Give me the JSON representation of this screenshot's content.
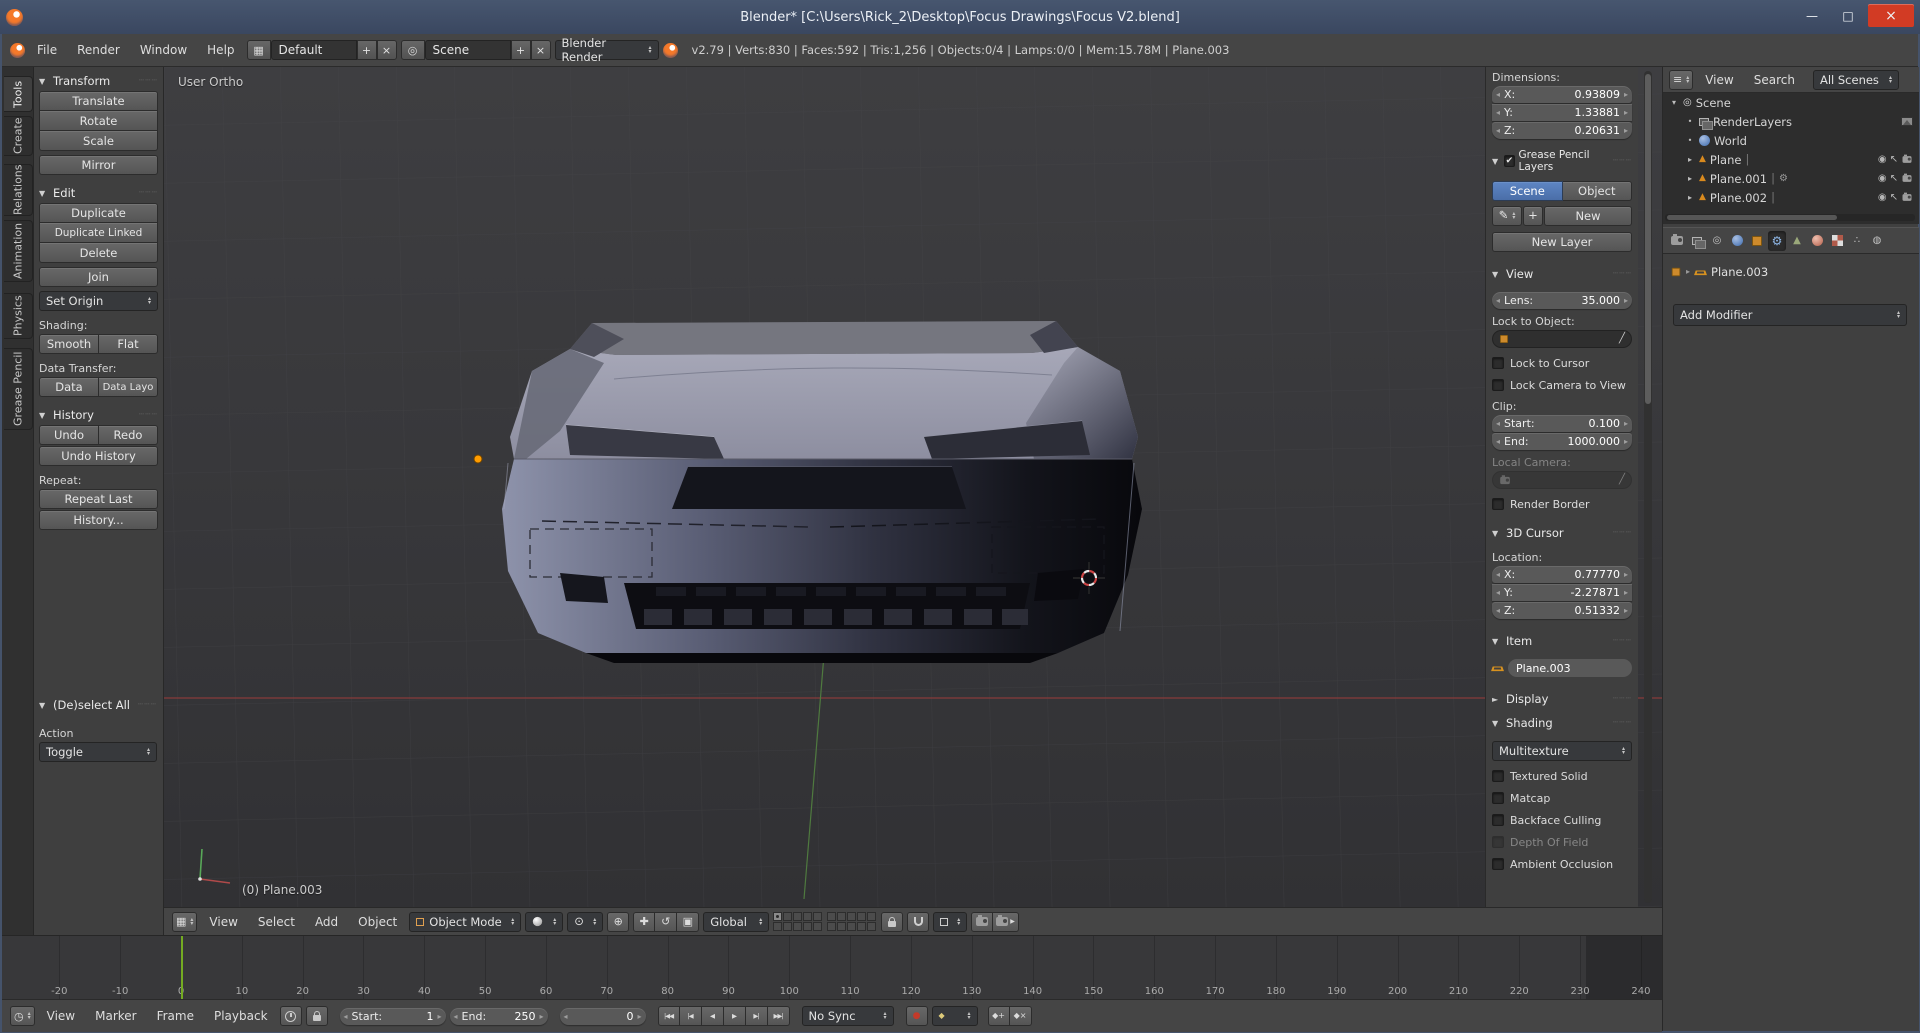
{
  "colors": {
    "accent_blue": "#5b80b8",
    "selection_orange": "#e8890c",
    "current_frame_green": "#74ab22",
    "close_red": "#d23b24",
    "titlebar_blue": "#3f4d68"
  },
  "icons": {
    "minimize": "—",
    "maximize": "□",
    "close": "×",
    "plus": "+",
    "remove": "×",
    "tri_down": "▼",
    "tri_right": "►",
    "arrow_left": "◂",
    "arrow_right": "▸",
    "check": "✔",
    "grip": "┄┄┄",
    "pipe": "|",
    "bullet": "•",
    "dis_down": "▾",
    "dis_right": "▸",
    "eye": "◉",
    "cursor_arrow": "↖",
    "wrench": "⚙",
    "pencil": "✎",
    "dropper": "╱",
    "pivot": "⊙",
    "align": "⊕",
    "manip_translate": "✚",
    "manip_rotate": "↺",
    "manip_scale": "▣",
    "scene_glyph": "◎",
    "mesh_glyph": "▲",
    "editor_grid": "▦",
    "editor_clock": "◷",
    "outliner_glyph": "≡",
    "jump_start": "|◀◀",
    "prev_key": "|◀",
    "play_rev": "◀",
    "play": "▶",
    "next_key": "▶|",
    "jump_end": "▶▶|",
    "record": "●",
    "key": "◆",
    "key_add": "◆+",
    "key_del": "◆×",
    "particles": "∴",
    "physics": "◍"
  },
  "titlebar": {
    "title": "Blender* [C:\\Users\\Rick_2\\Desktop\\Focus Drawings\\Focus V2.blend]"
  },
  "infobar": {
    "menus": [
      "File",
      "Render",
      "Window",
      "Help"
    ],
    "layout_name": "Default",
    "scene_name": "Scene",
    "engine": "Blender Render",
    "stats": "v2.79 | Verts:830 | Faces:592 | Tris:1,256 | Objects:0/4 | Lamps:0/0 | Mem:15.78M | Plane.003"
  },
  "toolshelf": {
    "tabs": [
      "Tools",
      "Create",
      "Relations",
      "Animation",
      "Physics",
      "Grease Pencil"
    ],
    "transform_title": "Transform",
    "translate": "Translate",
    "rotate": "Rotate",
    "scale": "Scale",
    "mirror": "Mirror",
    "edit_title": "Edit",
    "duplicate": "Duplicate",
    "duplicate_linked": "Duplicate Linked",
    "delete": "Delete",
    "join": "Join",
    "set_origin": "Set Origin",
    "shading_label": "Shading:",
    "smooth": "Smooth",
    "flat": "Flat",
    "data_transfer_label": "Data Transfer:",
    "data": "Data",
    "data_layout": "Data Layo",
    "history_title": "History",
    "undo": "Undo",
    "redo": "Redo",
    "undo_history": "Undo History",
    "repeat_label": "Repeat:",
    "repeat_last": "Repeat Last",
    "history_menu": "History...",
    "redo_title": "(De)select All",
    "action_label": "Action",
    "toggle": "Toggle"
  },
  "viewport": {
    "view_label": "User Ortho",
    "object_label": "(0) Plane.003",
    "menus": [
      "View",
      "Select",
      "Add",
      "Object"
    ],
    "mode": "Object Mode",
    "orientation": "Global"
  },
  "npanel": {
    "dimensions_label": "Dimensions:",
    "dim_x_label": "X:",
    "dim_x": "0.93809",
    "dim_y_label": "Y:",
    "dim_y": "1.33881",
    "dim_z_label": "Z:",
    "dim_z": "0.20631",
    "gp_title": "Grease Pencil Layers",
    "gp_scene": "Scene",
    "gp_object": "Object",
    "gp_new": "New",
    "gp_new_layer": "New Layer",
    "view_title": "View",
    "lens_label": "Lens:",
    "lens_value": "35.000",
    "lock_obj_label": "Lock to Object:",
    "lock_cursor": "Lock to Cursor",
    "lock_cam": "Lock Camera to View",
    "clip_label": "Clip:",
    "clip_start_label": "Start:",
    "clip_start": "0.100",
    "clip_end_label": "End:",
    "clip_end": "1000.000",
    "local_cam_label": "Local Camera:",
    "render_border": "Render Border",
    "cursor_title": "3D Cursor",
    "location_label": "Location:",
    "cur_x_label": "X:",
    "cur_x": "0.77770",
    "cur_y_label": "Y:",
    "cur_y": "-2.27871",
    "cur_z_label": "Z:",
    "cur_z": "0.51332",
    "item_title": "Item",
    "item_name": "Plane.003",
    "display_title": "Display",
    "shading_title": "Shading",
    "shading_mode": "Multitexture",
    "cb_textured": "Textured Solid",
    "cb_matcap": "Matcap",
    "cb_backface": "Backface Culling",
    "cb_dof": "Depth Of Field",
    "cb_ao": "Ambient Occlusion"
  },
  "outliner": {
    "menu_view": "View",
    "menu_search": "Search",
    "display_mode": "All Scenes",
    "rows": [
      {
        "label": "Scene"
      },
      {
        "label": "RenderLayers"
      },
      {
        "label": "World"
      },
      {
        "label": "Plane"
      },
      {
        "label": "Plane.001"
      },
      {
        "label": "Plane.002"
      }
    ]
  },
  "properties": {
    "object_name": "Plane.003",
    "add_modifier": "Add Modifier"
  },
  "timeline": {
    "menus": [
      "View",
      "Marker",
      "Frame",
      "Playback"
    ],
    "start_label": "Start:",
    "start_value": "1",
    "end_label": "End:",
    "end_value": "250",
    "frame_value": "0",
    "sync": "No Sync",
    "frame_labels": [
      "-20",
      "-10",
      "0",
      "10",
      "20",
      "30",
      "40",
      "50",
      "60",
      "70",
      "80",
      "90",
      "100",
      "110",
      "120",
      "130",
      "140",
      "150",
      "160",
      "170",
      "180",
      "190",
      "200",
      "210",
      "220",
      "230",
      "240"
    ],
    "current_frame": 0
  }
}
